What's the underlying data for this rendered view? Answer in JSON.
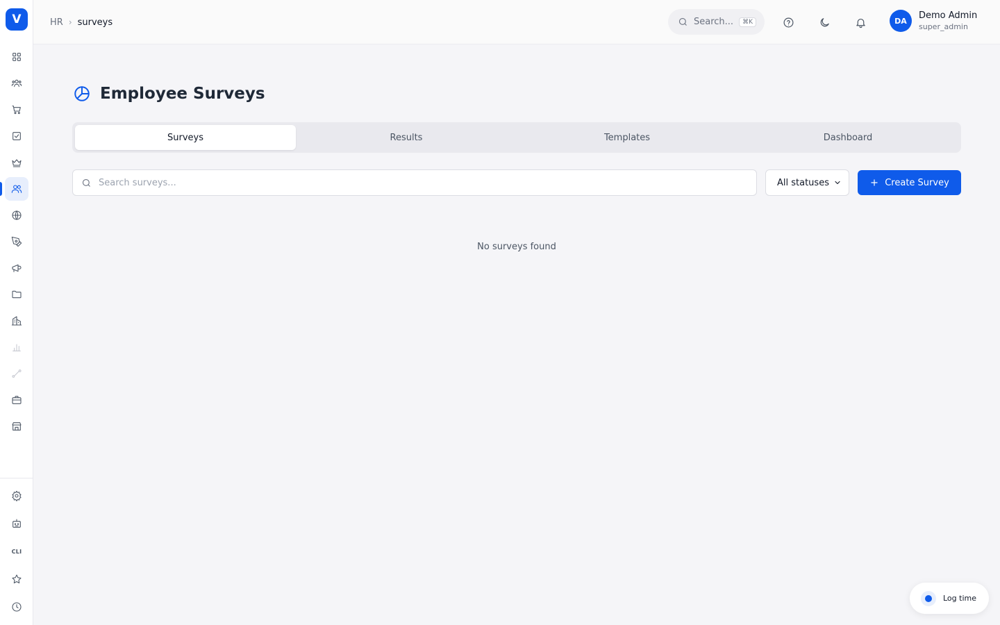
{
  "app": {
    "logo_letter": "V",
    "accent_color": "#0f5bea"
  },
  "sidebar": {
    "items": [
      {
        "icon": "grid-icon"
      },
      {
        "icon": "team-icon"
      },
      {
        "icon": "cart-icon"
      },
      {
        "icon": "checkbox-icon"
      },
      {
        "icon": "crown-icon"
      },
      {
        "icon": "users-icon",
        "active": true
      },
      {
        "icon": "globe-icon"
      },
      {
        "icon": "pen-tool-icon"
      },
      {
        "icon": "megaphone-icon"
      },
      {
        "icon": "folder-icon"
      },
      {
        "icon": "building-icon"
      },
      {
        "icon": "bar-chart-icon"
      },
      {
        "icon": "route-icon"
      },
      {
        "icon": "briefcase-icon"
      },
      {
        "icon": "store-icon"
      }
    ],
    "bottom_items": [
      {
        "icon": "settings-icon"
      },
      {
        "icon": "bot-icon"
      },
      {
        "label": "CLI"
      },
      {
        "icon": "star-icon"
      },
      {
        "icon": "clock-icon"
      }
    ]
  },
  "header": {
    "breadcrumb": {
      "root": "HR",
      "current": "surveys"
    },
    "search": {
      "placeholder": "Search...",
      "shortcut": "⌘K"
    },
    "user": {
      "initials": "DA",
      "name": "Demo Admin",
      "role": "super_admin"
    }
  },
  "main": {
    "title": "Employee Surveys",
    "tabs": [
      {
        "label": "Surveys",
        "active": true
      },
      {
        "label": "Results"
      },
      {
        "label": "Templates"
      },
      {
        "label": "Dashboard"
      }
    ],
    "search": {
      "placeholder": "Search surveys...",
      "value": ""
    },
    "status_filter": {
      "selected": "All statuses"
    },
    "create_label": "Create Survey",
    "empty_message": "No surveys found"
  },
  "log_time": {
    "label": "Log time"
  }
}
